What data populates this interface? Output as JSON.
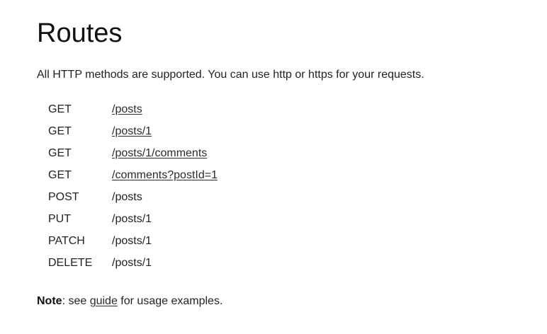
{
  "page": {
    "title": "Routes",
    "intro": "All HTTP methods are supported. You can use http or https for your requests."
  },
  "routes": [
    {
      "method": "GET",
      "path": "/posts",
      "link": true
    },
    {
      "method": "GET",
      "path": "/posts/1",
      "link": true
    },
    {
      "method": "GET",
      "path": "/posts/1/comments",
      "link": true
    },
    {
      "method": "GET",
      "path": "/comments?postId=1",
      "link": true
    },
    {
      "method": "POST",
      "path": "/posts",
      "link": false
    },
    {
      "method": "PUT",
      "path": "/posts/1",
      "link": false
    },
    {
      "method": "PATCH",
      "path": "/posts/1",
      "link": false
    },
    {
      "method": "DELETE",
      "path": "/posts/1",
      "link": false
    }
  ],
  "note": {
    "label": "Note",
    "text_before": ": see ",
    "link_text": "guide",
    "text_after": " for usage examples."
  }
}
